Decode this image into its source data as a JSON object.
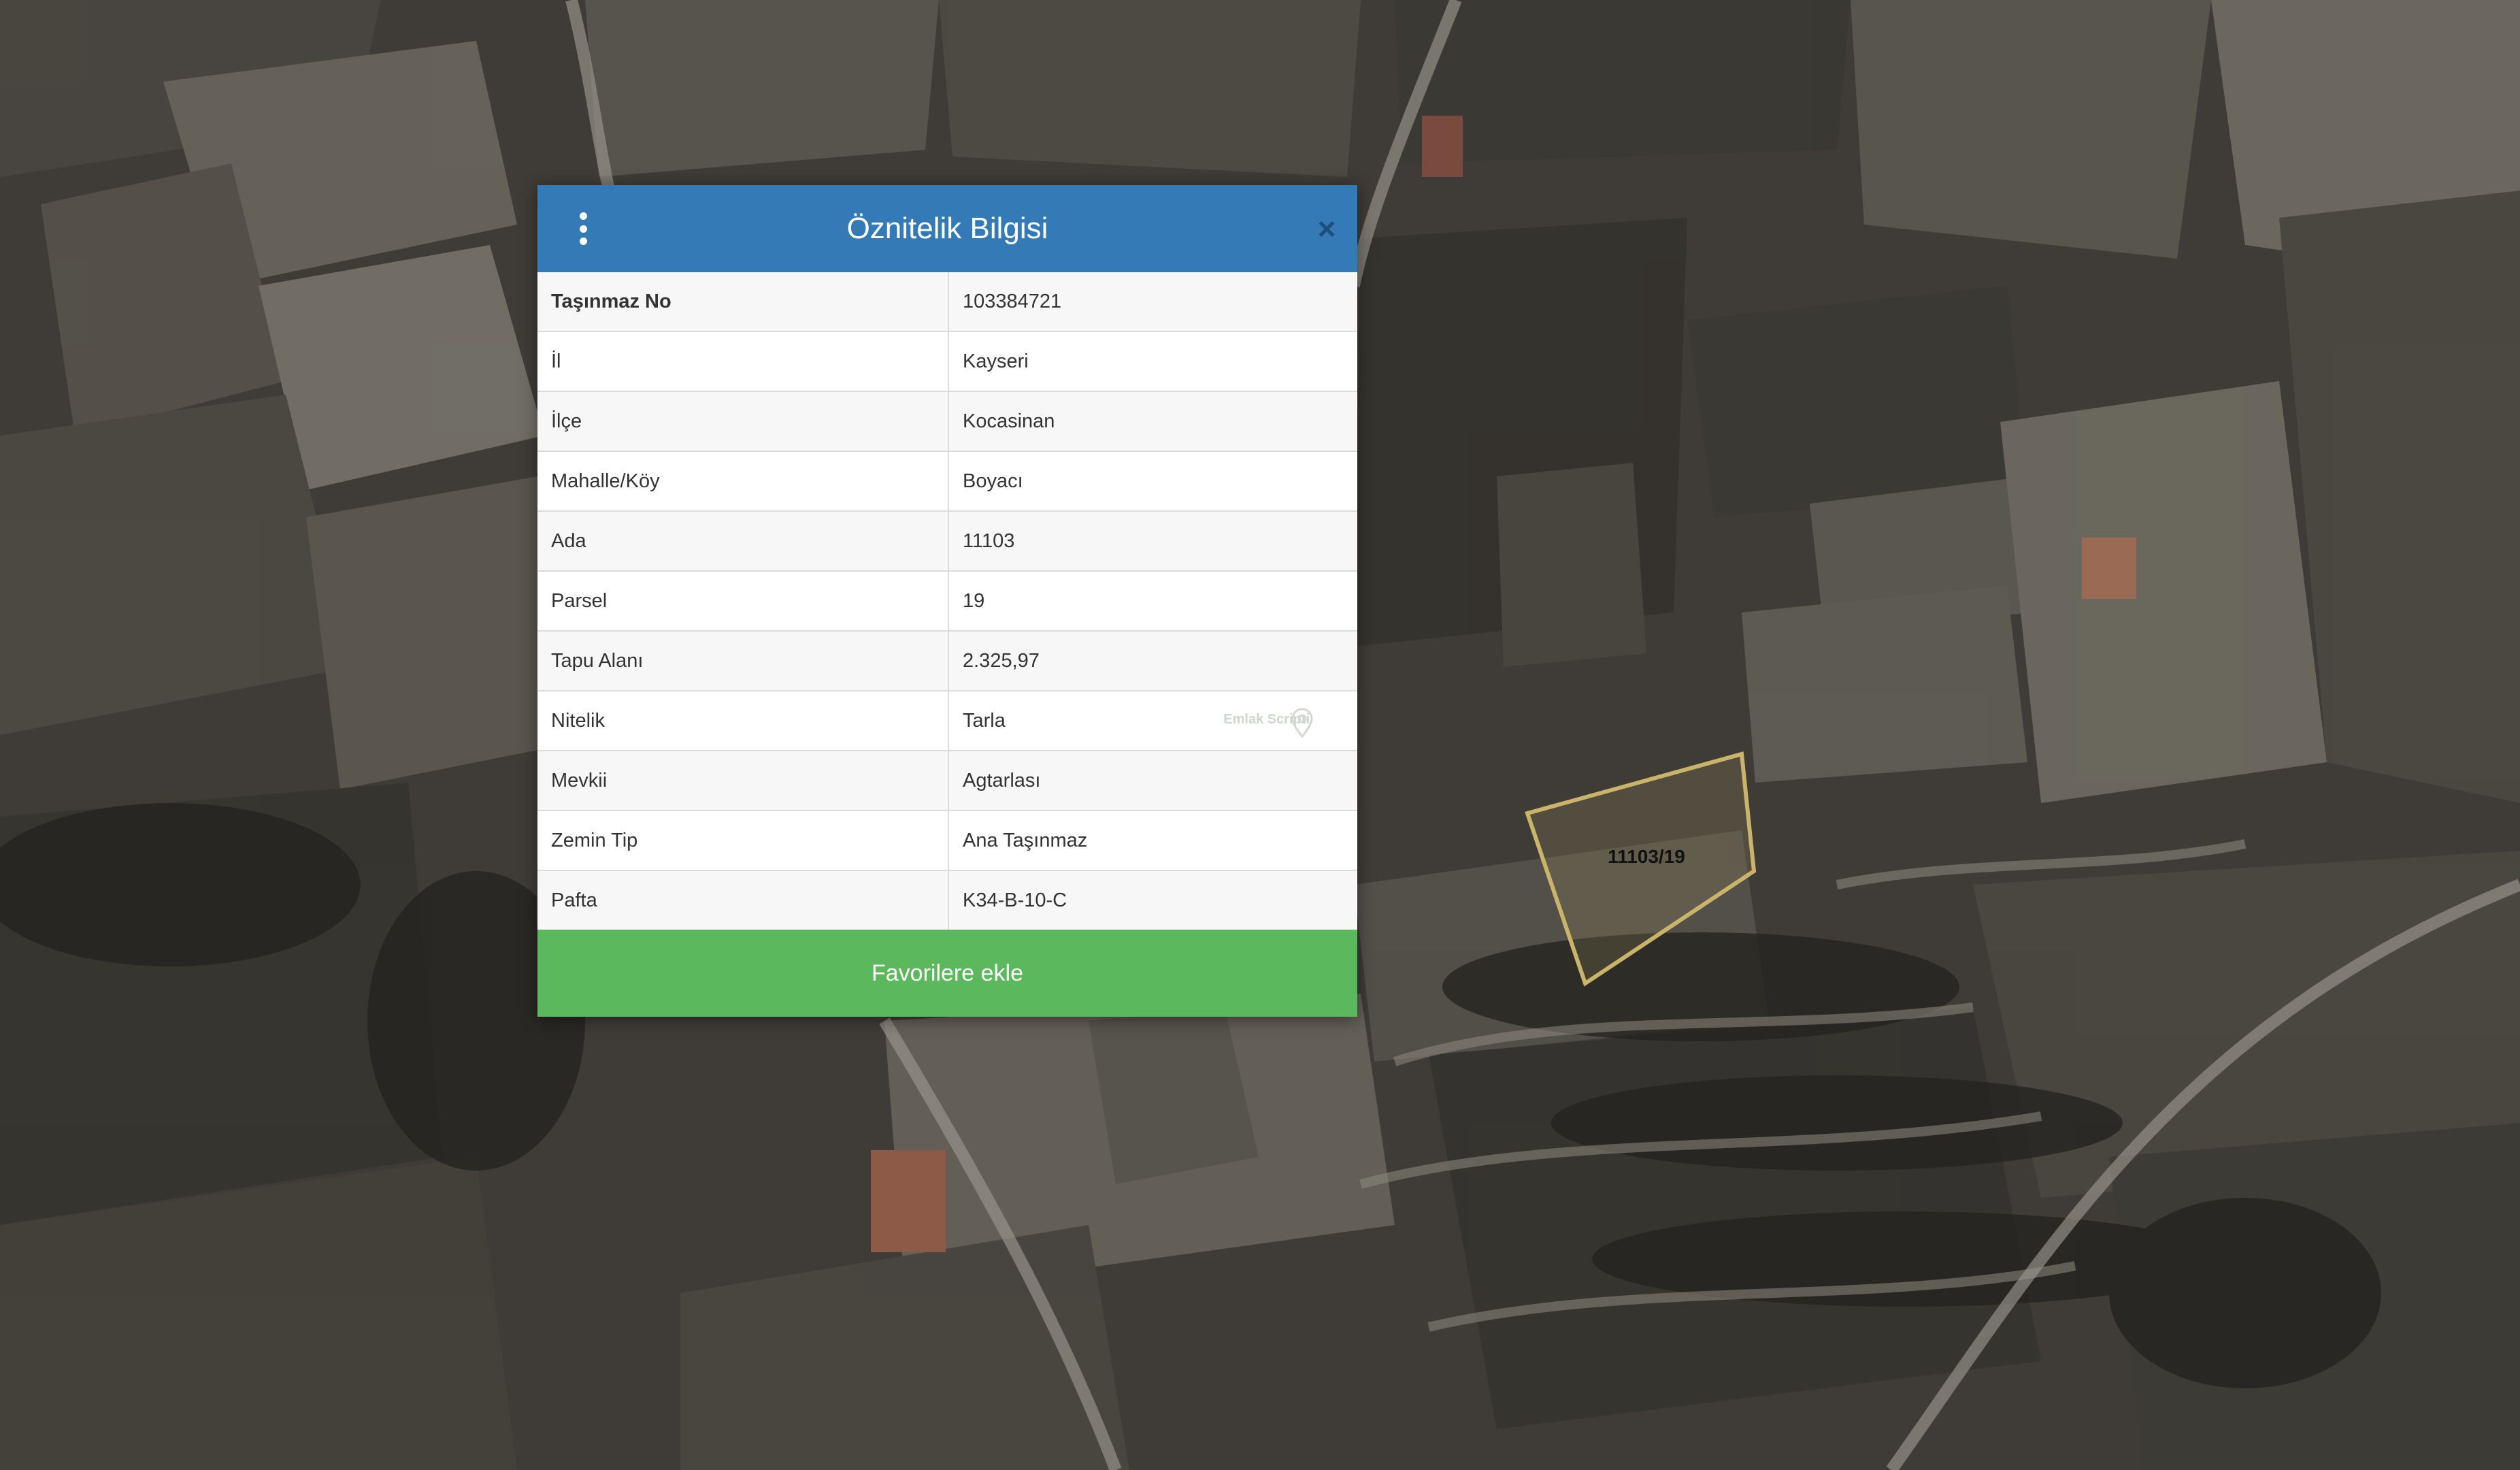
{
  "dialog": {
    "title": "Öznitelik Bilgisi",
    "rows": [
      {
        "key": "Taşınmaz No",
        "value": "103384721"
      },
      {
        "key": "İl",
        "value": "Kayseri"
      },
      {
        "key": "İlçe",
        "value": "Kocasinan"
      },
      {
        "key": "Mahalle/Köy",
        "value": "Boyacı"
      },
      {
        "key": "Ada",
        "value": "11103"
      },
      {
        "key": "Parsel",
        "value": "19"
      },
      {
        "key": "Tapu Alanı",
        "value": "2.325,97"
      },
      {
        "key": "Nitelik",
        "value": "Tarla"
      },
      {
        "key": "Mevkii",
        "value": "Agtarlası"
      },
      {
        "key": "Zemin Tip",
        "value": "Ana Taşınmaz"
      },
      {
        "key": "Pafta",
        "value": "K34-B-10-C"
      }
    ],
    "watermark": "Emlak Scripti",
    "favorite_label": "Favorilere ekle",
    "icons": {
      "menu": "kebab-menu-icon",
      "close": "close-icon",
      "watermark": "map-pin-icon"
    }
  },
  "map": {
    "parcel_label": "11103/19",
    "parcel_outline_color": "#c9b46a",
    "header_color": "#337ab7",
    "button_color": "#5cb85c"
  }
}
